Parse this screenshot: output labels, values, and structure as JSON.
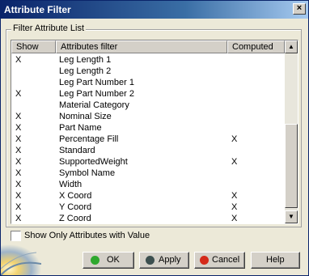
{
  "window": {
    "title": "Attribute Filter"
  },
  "icons": {
    "close": "close-icon",
    "ok": "green-dot-icon",
    "apply": "dark-dot-icon",
    "cancel": "red-dot-icon"
  },
  "colors": {
    "ok_dot": "#2ea82e",
    "apply_dot": "#3c4f4f",
    "cancel_dot": "#d42a1a"
  },
  "group": {
    "label": "Filter Attribute List",
    "columns": [
      "Show",
      "Attributes filter",
      "Computed"
    ],
    "rows": [
      {
        "show": "X",
        "name": "Leg Length 1",
        "computed": ""
      },
      {
        "show": "",
        "name": "Leg Length 2",
        "computed": ""
      },
      {
        "show": "",
        "name": "Leg Part Number 1",
        "computed": ""
      },
      {
        "show": "X",
        "name": "Leg Part Number 2",
        "computed": ""
      },
      {
        "show": "",
        "name": "Material Category",
        "computed": ""
      },
      {
        "show": "X",
        "name": "Nominal Size",
        "computed": ""
      },
      {
        "show": "X",
        "name": "Part Name",
        "computed": ""
      },
      {
        "show": "X",
        "name": "Percentage Fill",
        "computed": "X"
      },
      {
        "show": "X",
        "name": "Standard",
        "computed": ""
      },
      {
        "show": "X",
        "name": "SupportedWeight",
        "computed": "X"
      },
      {
        "show": "X",
        "name": "Symbol Name",
        "computed": ""
      },
      {
        "show": "X",
        "name": "Width",
        "computed": ""
      },
      {
        "show": "X",
        "name": "X Coord",
        "computed": "X"
      },
      {
        "show": "X",
        "name": "Y Coord",
        "computed": "X"
      },
      {
        "show": "X",
        "name": "Z Coord",
        "computed": "X"
      }
    ]
  },
  "show_only_with_value": {
    "label": "Show Only Attributes with Value",
    "checked": false
  },
  "buttons": {
    "ok": "OK",
    "apply": "Apply",
    "cancel": "Cancel",
    "help": "Help"
  }
}
